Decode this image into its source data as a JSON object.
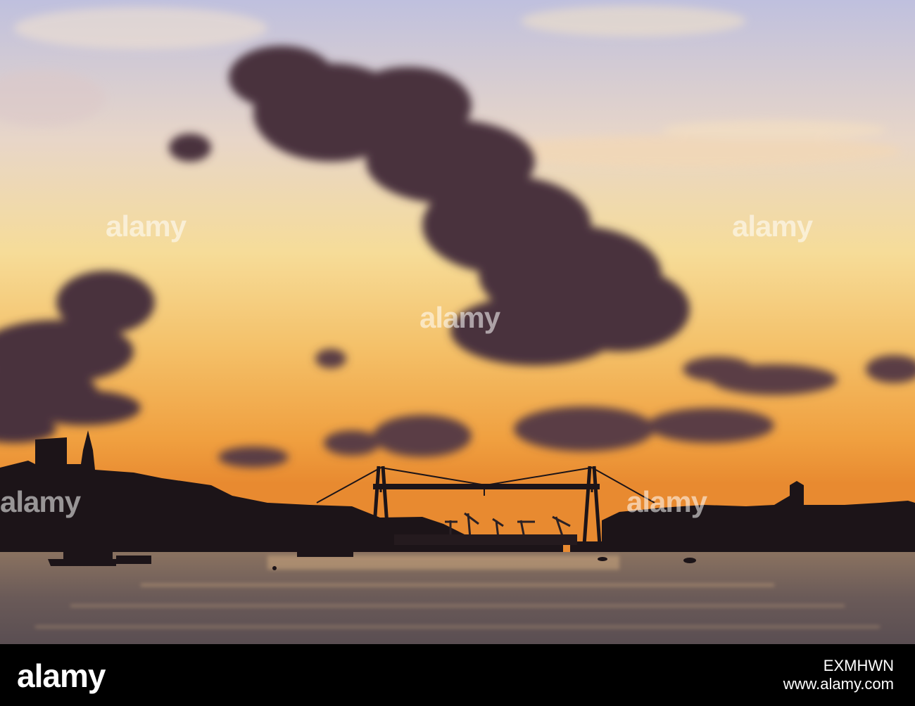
{
  "scene": {
    "description_colors": {
      "sky_top": "#c9c4dc",
      "sky_mid": "#f4d28a",
      "sky_horizon": "#f2a43a",
      "cloud": "#4a3540",
      "silhouette": "#1a1418",
      "water": "#6a5a50"
    }
  },
  "watermark": {
    "text": "alamy"
  },
  "footer": {
    "logo": "alamy",
    "image_id": "EXMHWN",
    "url": "www.alamy.com"
  }
}
